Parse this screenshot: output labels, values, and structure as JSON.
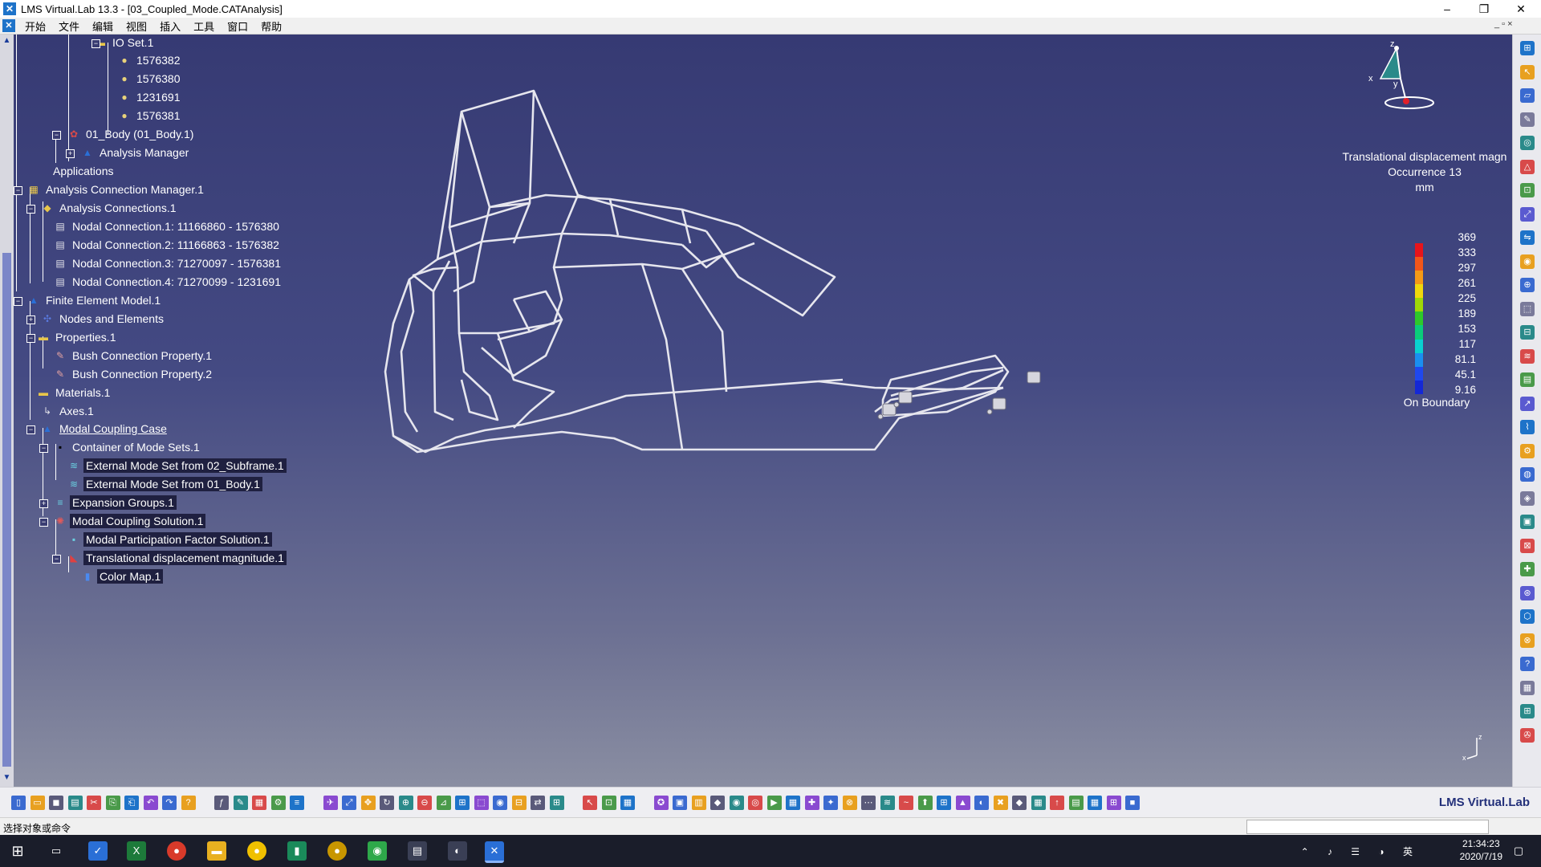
{
  "window": {
    "title": "LMS Virtual.Lab 13.3 - [03_Coupled_Mode.CATAnalysis]",
    "minimize": "–",
    "restore": "❐",
    "close": "✕"
  },
  "menu": {
    "items": [
      "开始",
      "文件",
      "编辑",
      "视图",
      "插入",
      "工具",
      "窗口",
      "帮助"
    ],
    "doc_controls": "_ ▫ ×"
  },
  "tree": {
    "nodes": [
      {
        "label": "IO Set.1",
        "icon": "folder-icon"
      },
      {
        "label": "1576382",
        "icon": "point-icon"
      },
      {
        "label": "1576380",
        "icon": "point-icon"
      },
      {
        "label": "1231691",
        "icon": "point-icon"
      },
      {
        "label": "1576381",
        "icon": "point-icon"
      },
      {
        "label": "01_Body (01_Body.1)",
        "icon": "product-icon"
      },
      {
        "label": "Analysis Manager",
        "icon": "analysis-manager-icon"
      },
      {
        "label": "Applications",
        "icon": ""
      },
      {
        "label": "Analysis Connection Manager.1",
        "icon": "connection-manager-icon"
      },
      {
        "label": "Analysis Connections.1",
        "icon": "connections-icon"
      },
      {
        "label": "Nodal Connection.1: 11166860 - 1576380",
        "icon": "nodal-connection-icon"
      },
      {
        "label": "Nodal Connection.2: 11166863 - 1576382",
        "icon": "nodal-connection-icon"
      },
      {
        "label": "Nodal Connection.3: 71270097 - 1576381",
        "icon": "nodal-connection-icon"
      },
      {
        "label": "Nodal Connection.4: 71270099 - 1231691",
        "icon": "nodal-connection-icon"
      },
      {
        "label": "Finite Element Model.1",
        "icon": "fem-icon"
      },
      {
        "label": "Nodes and Elements",
        "icon": "nodes-elements-icon"
      },
      {
        "label": "Properties.1",
        "icon": "folder-icon"
      },
      {
        "label": "Bush Connection Property.1",
        "icon": "bush-property-icon"
      },
      {
        "label": "Bush Connection Property.2",
        "icon": "bush-property-icon"
      },
      {
        "label": "Materials.1",
        "icon": "folder-icon"
      },
      {
        "label": "Axes.1",
        "icon": "axes-icon"
      },
      {
        "label": "Modal Coupling Case",
        "icon": "case-icon"
      },
      {
        "label": "Container of Mode Sets.1",
        "icon": "mode-sets-icon"
      },
      {
        "label": "External Mode Set from 02_Subframe.1",
        "icon": "mode-set-icon"
      },
      {
        "label": "External Mode Set from 01_Body.1",
        "icon": "mode-set-icon"
      },
      {
        "label": "Expansion Groups.1",
        "icon": "expansion-icon"
      },
      {
        "label": "Modal Coupling Solution.1",
        "icon": "solution-icon"
      },
      {
        "label": "Modal Participation Factor Solution.1",
        "icon": "pf-icon"
      },
      {
        "label": "Translational displacement magnitude.1",
        "icon": "displacement-icon"
      },
      {
        "label": "Color Map.1",
        "icon": "color-map-icon"
      }
    ],
    "small_labels": {
      "ms": "MS",
      "pf": "PF",
      "eg": "EG"
    }
  },
  "legend": {
    "title": "Translational displacement magn",
    "occurrence": "Occurrence 13",
    "unit": "mm",
    "values": [
      "369",
      "333",
      "297",
      "261",
      "225",
      "189",
      "153",
      "117",
      "81.1",
      "45.1",
      "9.16"
    ],
    "footer": "On Boundary",
    "colors": [
      "#e8141b",
      "#f2561a",
      "#f59a16",
      "#f0d80c",
      "#9fd806",
      "#2ec92a",
      "#0bcc7a",
      "#0ad0d0",
      "#1a8ff0",
      "#1f48ee",
      "#1428d6"
    ]
  },
  "compass": {
    "x": "x",
    "y": "y",
    "z": "z"
  },
  "bottom_toolbar": {
    "brand": "LMS Virtual.Lab"
  },
  "status": {
    "prompt": "选择对象或命令"
  },
  "taskbar": {
    "time": "21:34:23",
    "date": "2020/7/19",
    "ime": "英"
  },
  "colors": {
    "viewport_top": "#363a73",
    "viewport_bottom": "#8a8ea2",
    "wireframe": "#e6e6ee",
    "selection_box": "#1f2040"
  }
}
